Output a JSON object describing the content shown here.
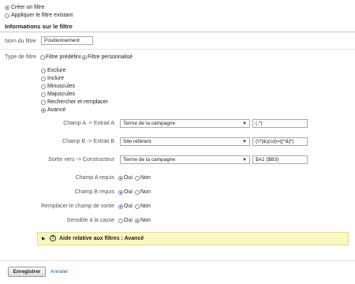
{
  "mode": {
    "create_label": "Créer un filtre",
    "apply_label": "Appliquer le filtre existant",
    "selected": "create"
  },
  "section_title": "Informations sur le filtre",
  "filter_name": {
    "label": "Nom du filtre",
    "value": "Positionnement"
  },
  "filter_type": {
    "label": "Type de filtre",
    "predefined_label": "Filtre prédéfini",
    "custom_label": "Filtre personnalisé",
    "selected": "custom"
  },
  "custom_options": {
    "items": [
      "Exclure",
      "Inclure",
      "Minuscules",
      "Majuscules",
      "Rechercher et remplacer",
      "Avancé"
    ],
    "selected": "Avancé"
  },
  "fields": {
    "field_a": {
      "label": "Champ A -> Extrait A",
      "select": "Terme de la campagne",
      "pattern": "(.*)"
    },
    "field_b": {
      "label": "Champ B -> Extrait B",
      "select": "Site référent",
      "pattern": "(\\?|&)(cd)=([^&]*)"
    },
    "output": {
      "label": "Sortie vers -> Constructeur",
      "select": "Terme de la campagne",
      "pattern": "$A1 ($B3)"
    }
  },
  "options": {
    "yes_label": "Oui",
    "no_label": "Non",
    "rows": [
      {
        "label": "Champ A requis",
        "selected": "yes"
      },
      {
        "label": "Champ B requis",
        "selected": "yes"
      },
      {
        "label": "Remplacer le champ de sortie",
        "selected": "yes"
      },
      {
        "label": "Sensible à la casse",
        "selected": "no"
      }
    ]
  },
  "help": {
    "label": "Aide relative aux filtres : Avancé"
  },
  "actions": {
    "save_label": "Enregistrer",
    "cancel_label": "Annuler"
  },
  "colors": {
    "help_background": "#fbf7c3",
    "link": "#1f4ea8",
    "radio_selected": "#1a4fd6"
  }
}
